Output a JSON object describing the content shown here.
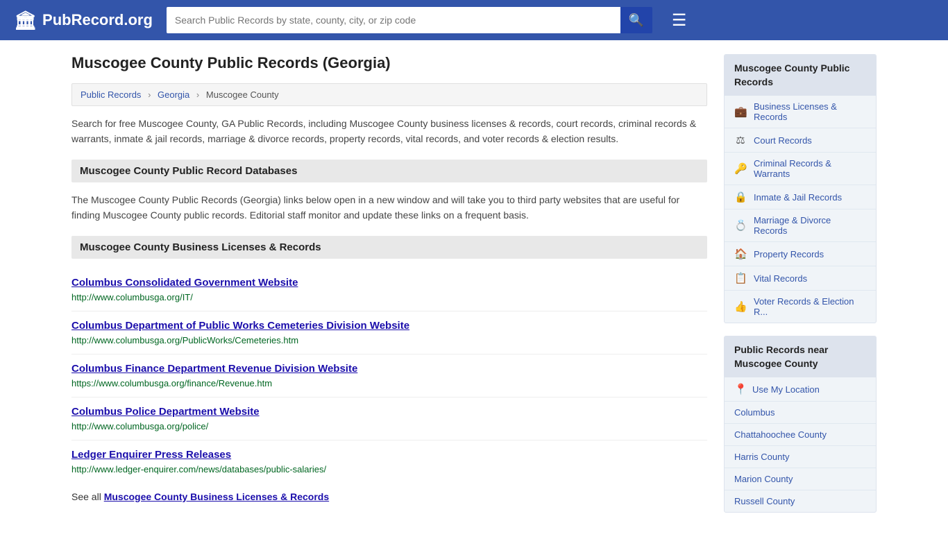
{
  "header": {
    "logo_icon": "🏛",
    "logo_text": "PubRecord.org",
    "search_placeholder": "Search Public Records by state, county, city, or zip code",
    "search_icon": "🔍",
    "menu_icon": "☰"
  },
  "page": {
    "title": "Muscogee County Public Records (Georgia)",
    "breadcrumb": {
      "items": [
        "Public Records",
        "Georgia",
        "Muscogee County"
      ]
    },
    "description": "Search for free Muscogee County, GA Public Records, including Muscogee County business licenses & records, court records, criminal records & warrants, inmate & jail records, marriage & divorce records, property records, vital records, and voter records & election results.",
    "databases_section": {
      "header": "Muscogee County Public Record Databases",
      "body": "The Muscogee County Public Records (Georgia) links below open in a new window and will take you to third party websites that are useful for finding Muscogee County public records. Editorial staff monitor and update these links on a frequent basis."
    },
    "business_section": {
      "header": "Muscogee County Business Licenses & Records",
      "records": [
        {
          "title": "Columbus Consolidated Government Website",
          "url": "http://www.columbusga.org/IT/"
        },
        {
          "title": "Columbus Department of Public Works Cemeteries Division Website",
          "url": "http://www.columbusga.org/PublicWorks/Cemeteries.htm"
        },
        {
          "title": "Columbus Finance Department Revenue Division Website",
          "url": "https://www.columbusga.org/finance/Revenue.htm"
        },
        {
          "title": "Columbus Police Department Website",
          "url": "http://www.columbusga.org/police/"
        },
        {
          "title": "Ledger Enquirer Press Releases",
          "url": "http://www.ledger-enquirer.com/news/databases/public-salaries/"
        }
      ],
      "see_all_text": "See all ",
      "see_all_link": "Muscogee County Business Licenses & Records"
    }
  },
  "sidebar": {
    "public_records": {
      "title": "Muscogee County Public Records",
      "items": [
        {
          "icon": "💼",
          "label": "Business Licenses & Records"
        },
        {
          "icon": "⚖",
          "label": "Court Records"
        },
        {
          "icon": "🔑",
          "label": "Criminal Records & Warrants"
        },
        {
          "icon": "🔒",
          "label": "Inmate & Jail Records"
        },
        {
          "icon": "💍",
          "label": "Marriage & Divorce Records"
        },
        {
          "icon": "🏠",
          "label": "Property Records"
        },
        {
          "icon": "📋",
          "label": "Vital Records"
        },
        {
          "icon": "👍",
          "label": "Voter Records & Election R..."
        }
      ]
    },
    "nearby": {
      "title": "Public Records near Muscogee County",
      "use_location_label": "Use My Location",
      "locations": [
        "Columbus",
        "Chattahoochee County",
        "Harris County",
        "Marion County",
        "Russell County"
      ]
    }
  }
}
